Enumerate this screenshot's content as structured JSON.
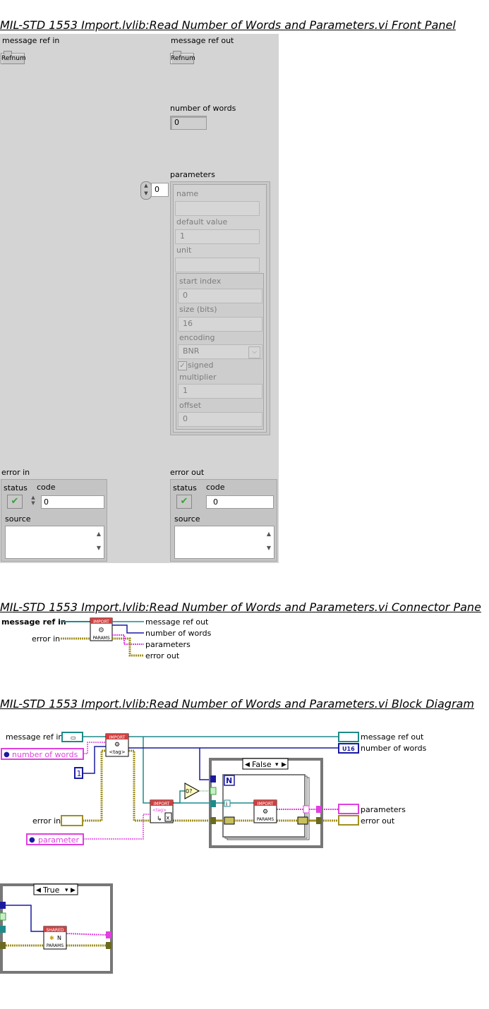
{
  "headings": {
    "front_panel": "MIL-STD 1553 Import.lvlib:Read Number of Words and Parameters.vi Front Panel",
    "connector_pane": "MIL-STD 1553 Import.lvlib:Read Number of Words and Parameters.vi Connector Pane",
    "block_diagram": "MIL-STD 1553 Import.lvlib:Read Number of Words and Parameters.vi Block Diagram"
  },
  "front_panel": {
    "message_ref_in": {
      "label": "message ref in",
      "refnum": "Refnum"
    },
    "message_ref_out": {
      "label": "message ref out",
      "refnum": "Refnum"
    },
    "number_of_words": {
      "label": "number of words",
      "value": "0"
    },
    "parameters": {
      "label": "parameters",
      "index": "0",
      "name_label": "name",
      "name_value": "",
      "default_label": "default value",
      "default_value": "1",
      "unit_label": "unit",
      "unit_value": "",
      "start_index_label": "start index",
      "start_index_value": "0",
      "size_label": "size (bits)",
      "size_value": "16",
      "encoding_label": "encoding",
      "encoding_value": "BNR",
      "signed_label": "signed",
      "multiplier_label": "multiplier",
      "multiplier_value": "1",
      "offset_label": "offset",
      "offset_value": "0"
    },
    "error_in": {
      "label": "error in",
      "status_label": "status",
      "code_label": "code",
      "code_value": "0",
      "source_label": "source"
    },
    "error_out": {
      "label": "error out",
      "status_label": "status",
      "code_label": "code",
      "code_value": "0",
      "source_label": "source"
    }
  },
  "connector_pane": {
    "left_top": "message ref in",
    "left_bottom": "error in",
    "icon_top": "IMPORT",
    "icon_bottom": "PARAMS",
    "outputs": [
      "message ref out",
      "number of words",
      "parameters",
      "error out"
    ]
  },
  "block_diagram": {
    "labels": {
      "message_ref_in": "message ref in",
      "number_of_words_ref": "number of words",
      "error_in": "error in",
      "parameter_ref": "parameter",
      "message_ref_out": "message ref out",
      "number_of_words_out": "number of words",
      "parameters_out": "parameters",
      "error_out": "error out"
    },
    "const_one": "1",
    "u16": "U16",
    "case_false": "False",
    "case_true": "True",
    "loop_n": "N",
    "import_tag_top": "IMPORT",
    "import_tag_sub": "<tag>",
    "import_x_top": "IMPORT",
    "import_x_sub": "<tag>",
    "import_params_top": "IMPORT",
    "import_params_bottom": "PARAMS",
    "shared_top": "SHARED",
    "shared_n": "N",
    "shared_bottom": "PARAMS",
    "eq_zero": "0?",
    "loop_i": "i"
  },
  "colors": {
    "panel_bg": "#d4d4d4",
    "refnum_wire": "#1f8a8a",
    "int_wire": "#1a1aa0",
    "string_wire": "#e040e0",
    "error_wire": "#a09020",
    "status_ok": "#3aa23a"
  }
}
